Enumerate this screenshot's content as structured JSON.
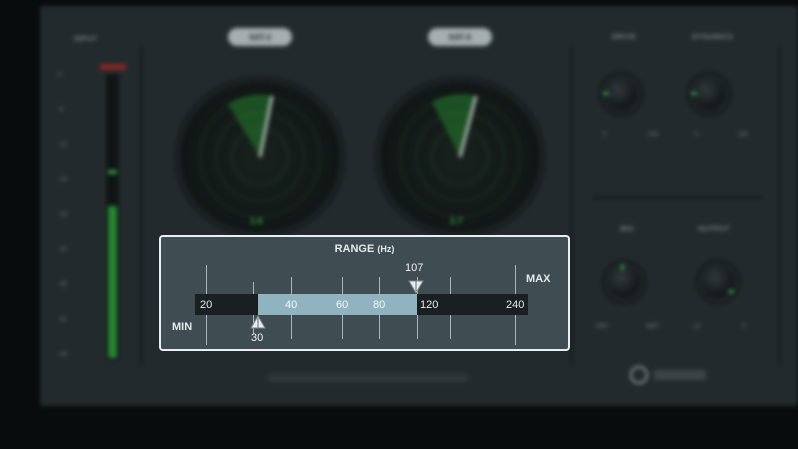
{
  "plugin": {
    "input_label": "INPUT",
    "db_scale": [
      "0",
      "-6",
      "-12",
      "-18",
      "-24",
      "-30",
      "-36",
      "-42",
      "-48"
    ],
    "sat_a_label": "SAT-2",
    "sat_b_label": "SAT-X",
    "drive_label": "DRIVE",
    "dynamics_label": "DYNAMICS",
    "mix_label": "MIX",
    "output_label": "OUTPUT",
    "dial_a_value": "1.6",
    "dial_b_value": "2.7",
    "drive_min": "0",
    "drive_max": "100",
    "dyn_min": "0",
    "dyn_max": "100",
    "mix_min": "DRY",
    "mix_max": "WET",
    "out_min": "-12",
    "out_max": "0",
    "meter_level": 0.54,
    "accent_color": "#3fc552"
  },
  "range_panel": {
    "title": "RANGE",
    "unit": "(Hz)",
    "min_label": "MIN",
    "max_label": "MAX",
    "scale": [
      "20",
      "40",
      "60",
      "80",
      "120",
      "240"
    ],
    "min_value": "30",
    "max_value": "107",
    "range_fill_color": "#8fb4bf"
  }
}
